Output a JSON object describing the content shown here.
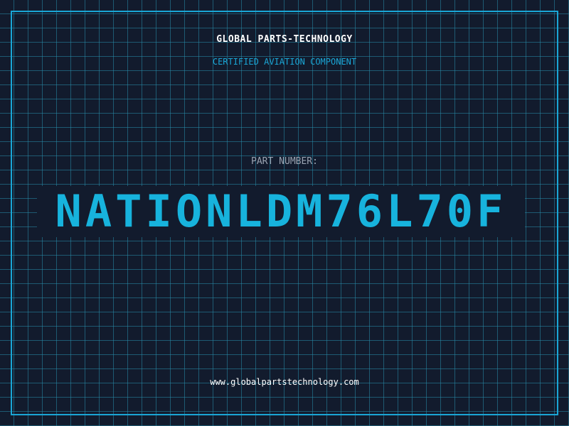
{
  "company_name": "GLOBAL PARTS-TECHNOLOGY",
  "subtitle": "CERTIFIED AVIATION COMPONENT",
  "part_label": "PART NUMBER:",
  "part_number": "NATIONLDM76L70F",
  "website": "www.globalpartstechnology.com",
  "colors": {
    "background": "#121b2d",
    "grid": "#288caa",
    "accent": "#1aa6d6",
    "text_primary": "#ffffff",
    "text_muted": "#9aa4b2"
  }
}
